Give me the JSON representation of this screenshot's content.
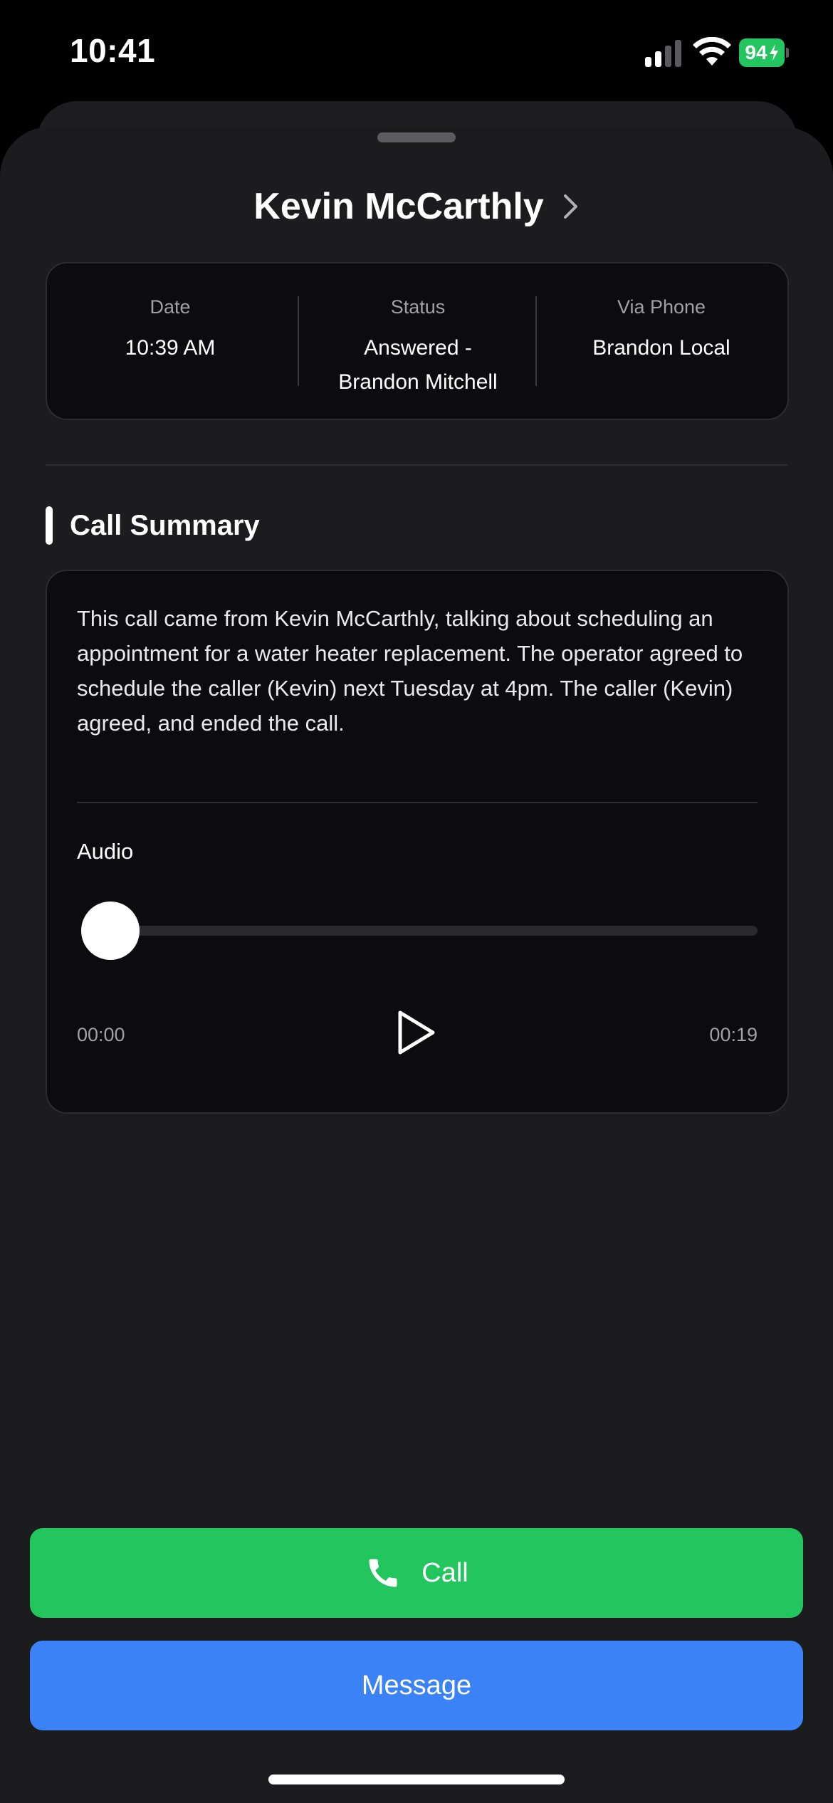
{
  "status_bar": {
    "time": "10:41",
    "battery": "94"
  },
  "contact": {
    "name": "Kevin McCarthly"
  },
  "call_info": [
    {
      "label": "Date",
      "value": "10:39 AM"
    },
    {
      "label": "Status",
      "value": "Answered -\nBrandon Mitchell"
    },
    {
      "label": "Via Phone",
      "value": "Brandon Local"
    }
  ],
  "summary": {
    "heading": "Call Summary",
    "text": "This call came from Kevin McCarthly, talking about scheduling an appointment for a water heater replacement. The operator agreed to schedule the caller (Kevin) next Tuesday at 4pm. The caller (Kevin) agreed, and ended the call.",
    "audio_label": "Audio",
    "current_time": "00:00",
    "duration": "00:19",
    "progress": 0
  },
  "actions": {
    "call_label": "Call",
    "message_label": "Message"
  },
  "colors": {
    "call": "#22c55e",
    "message": "#3b82f6",
    "battery": "#22c55e"
  },
  "icons": [
    "cellular-signal-icon",
    "wifi-icon",
    "battery-charging-icon",
    "chevron-right-icon",
    "play-icon",
    "phone-icon"
  ]
}
